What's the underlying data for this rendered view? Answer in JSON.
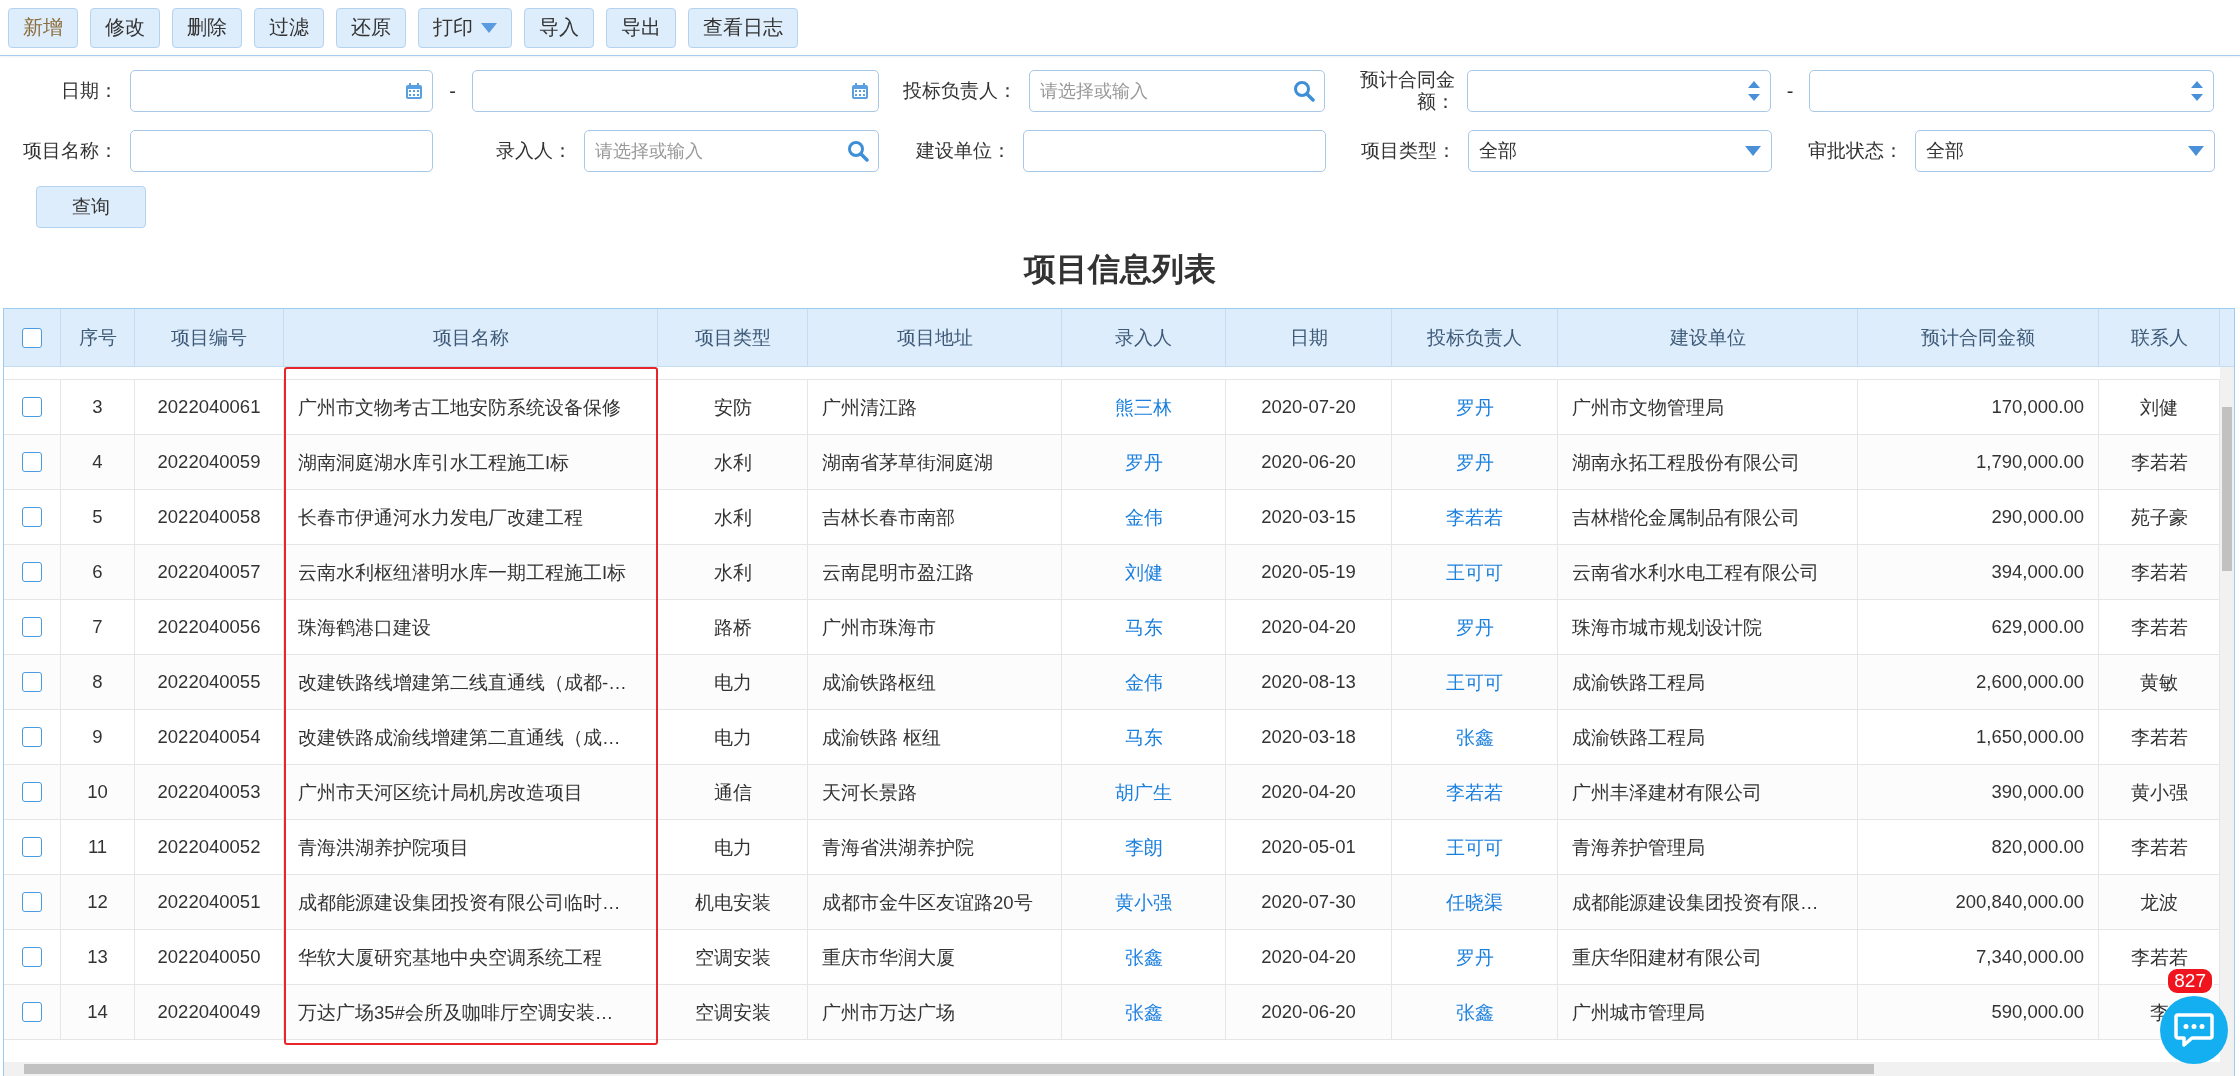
{
  "toolbar": [
    {
      "label": "新增",
      "focused": true,
      "dropdown": false
    },
    {
      "label": "修改",
      "focused": false,
      "dropdown": false
    },
    {
      "label": "删除",
      "focused": false,
      "dropdown": false
    },
    {
      "label": "过滤",
      "focused": false,
      "dropdown": false
    },
    {
      "label": "还原",
      "focused": false,
      "dropdown": false
    },
    {
      "label": "打印",
      "focused": false,
      "dropdown": true
    },
    {
      "label": "导入",
      "focused": false,
      "dropdown": false
    },
    {
      "label": "导出",
      "focused": false,
      "dropdown": false
    },
    {
      "label": "查看日志",
      "focused": false,
      "dropdown": false
    }
  ],
  "filters": [
    [
      {
        "kind": "label",
        "text": "日期："
      },
      {
        "kind": "date"
      },
      {
        "kind": "dash",
        "text": "-"
      },
      {
        "kind": "date"
      },
      {
        "kind": "label",
        "text": "投标负责人："
      },
      {
        "kind": "search",
        "placeholder": "请选择或输入"
      },
      {
        "kind": "label",
        "text": "预计合同金额："
      },
      {
        "kind": "number"
      },
      {
        "kind": "dash",
        "text": "-"
      },
      {
        "kind": "number"
      }
    ],
    [
      {
        "kind": "label",
        "text": "项目名称："
      },
      {
        "kind": "text"
      },
      {
        "kind": "label",
        "text": "录入人："
      },
      {
        "kind": "search",
        "placeholder": "请选择或输入"
      },
      {
        "kind": "label",
        "text": "建设单位："
      },
      {
        "kind": "text"
      },
      {
        "kind": "label",
        "text": "项目类型："
      },
      {
        "kind": "select",
        "value": "全部"
      },
      {
        "kind": "label",
        "text": "审批状态："
      },
      {
        "kind": "select",
        "value": "全部"
      }
    ]
  ],
  "query_button": "查询",
  "title": "项目信息列表",
  "table": {
    "all_checked": false,
    "columns": [
      {
        "label": "序号",
        "kind": "text",
        "highlighted": false
      },
      {
        "label": "项目编号",
        "kind": "text",
        "highlighted": false
      },
      {
        "label": "项目名称",
        "kind": "text",
        "highlighted": true
      },
      {
        "label": "项目类型",
        "kind": "text",
        "highlighted": false
      },
      {
        "label": "项目地址",
        "kind": "text",
        "highlighted": false
      },
      {
        "label": "录入人",
        "kind": "link",
        "highlighted": false
      },
      {
        "label": "日期",
        "kind": "text",
        "highlighted": false
      },
      {
        "label": "投标负责人",
        "kind": "link",
        "highlighted": false
      },
      {
        "label": "建设单位",
        "kind": "text",
        "highlighted": false
      },
      {
        "label": "预计合同金额",
        "kind": "text",
        "highlighted": false
      },
      {
        "label": "联系人",
        "kind": "text",
        "highlighted": false
      }
    ],
    "rows": [
      {
        "checked": false,
        "cells": [
          "3",
          "2022040061",
          "广州市文物考古工地安防系统设备保修",
          "安防",
          "广州清江路",
          "熊三林",
          "2020-07-20",
          "罗丹",
          "广州市文物管理局",
          "170,000.00",
          "刘健"
        ]
      },
      {
        "checked": false,
        "cells": [
          "4",
          "2022040059",
          "湖南洞庭湖水库引水工程施工I标",
          "水利",
          "湖南省茅草街洞庭湖",
          "罗丹",
          "2020-06-20",
          "罗丹",
          "湖南永拓工程股份有限公司",
          "1,790,000.00",
          "李若若"
        ]
      },
      {
        "checked": false,
        "cells": [
          "5",
          "2022040058",
          "长春市伊通河水力发电厂改建工程",
          "水利",
          "吉林长春市南部",
          "金伟",
          "2020-03-15",
          "李若若",
          "吉林楷伦金属制品有限公司",
          "290,000.00",
          "苑子豪"
        ]
      },
      {
        "checked": false,
        "cells": [
          "6",
          "2022040057",
          "云南水利枢纽潜明水库一期工程施工I标",
          "水利",
          "云南昆明市盈江路",
          "刘健",
          "2020-05-19",
          "王可可",
          "云南省水利水电工程有限公司",
          "394,000.00",
          "李若若"
        ]
      },
      {
        "checked": false,
        "cells": [
          "7",
          "2022040056",
          "珠海鹤港口建设",
          "路桥",
          "广州市珠海市",
          "马东",
          "2020-04-20",
          "罗丹",
          "珠海市城市规划设计院",
          "629,000.00",
          "李若若"
        ]
      },
      {
        "checked": false,
        "cells": [
          "8",
          "2022040055",
          "改建铁路线增建第二线直通线（成都-…",
          "电力",
          "成渝铁路枢纽",
          "金伟",
          "2020-08-13",
          "王可可",
          "成渝铁路工程局",
          "2,600,000.00",
          "黄敏"
        ]
      },
      {
        "checked": false,
        "cells": [
          "9",
          "2022040054",
          "改建铁路成渝线增建第二直通线（成…",
          "电力",
          "成渝铁路 枢纽",
          "马东",
          "2020-03-18",
          "张鑫",
          "成渝铁路工程局",
          "1,650,000.00",
          "李若若"
        ]
      },
      {
        "checked": false,
        "cells": [
          "10",
          "2022040053",
          "广州市天河区统计局机房改造项目",
          "通信",
          "天河长景路",
          "胡广生",
          "2020-04-20",
          "李若若",
          "广州丰泽建材有限公司",
          "390,000.00",
          "黄小强"
        ]
      },
      {
        "checked": false,
        "cells": [
          "11",
          "2022040052",
          "青海洪湖养护院项目",
          "电力",
          "青海省洪湖养护院",
          "李朗",
          "2020-05-01",
          "王可可",
          "青海养护管理局",
          "820,000.00",
          "李若若"
        ]
      },
      {
        "checked": false,
        "cells": [
          "12",
          "2022040051",
          "成都能源建设集团投资有限公司临时…",
          "机电安装",
          "成都市金牛区友谊路20号",
          "黄小强",
          "2020-07-30",
          "任晓渠",
          "成都能源建设集团投资有限…",
          "200,840,000.00",
          "龙波"
        ]
      },
      {
        "checked": false,
        "cells": [
          "13",
          "2022040050",
          "华软大厦研究基地中央空调系统工程",
          "空调安装",
          "重庆市华润大厦",
          "张鑫",
          "2020-04-20",
          "罗丹",
          "重庆华阳建材有限公司",
          "7,340,000.00",
          "李若若"
        ]
      },
      {
        "checked": false,
        "cells": [
          "14",
          "2022040049",
          "万达广场35#会所及咖啡厅空调安装…",
          "空调安装",
          "广州市万达广场",
          "张鑫",
          "2020-06-20",
          "张鑫",
          "广州城市管理局",
          "590,000.00",
          "李"
        ]
      }
    ]
  },
  "chat": {
    "badge": "827"
  }
}
